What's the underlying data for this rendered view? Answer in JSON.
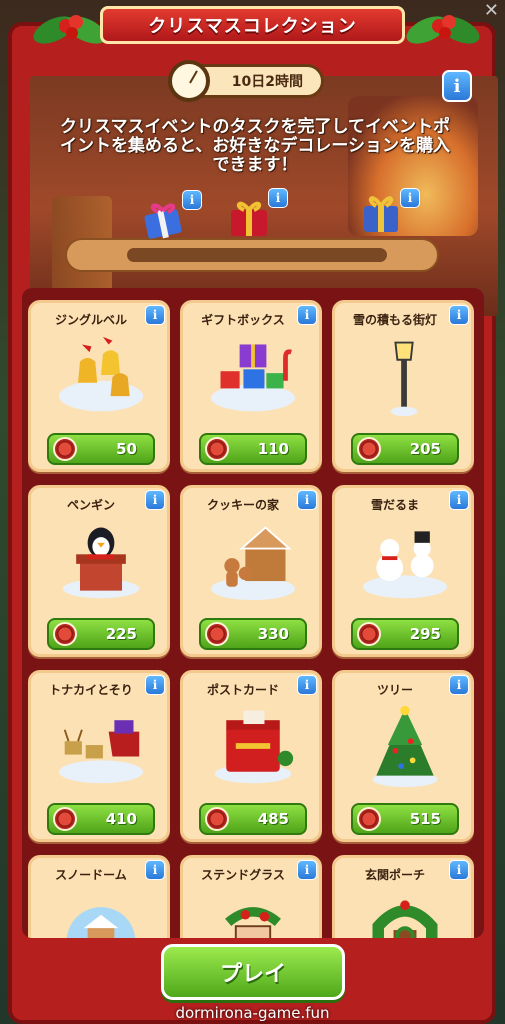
{
  "header": {
    "title": "クリスマスコレクション",
    "timer": "10日2時間",
    "description": "クリスマスイベントのタスクを完了してイベントポイントを集めると、お好きなデコレーションを購入できます！",
    "info_label": "i"
  },
  "progress": {
    "fraction": 0.0,
    "milestones": [
      "gift-blue-icon",
      "gift-red-icon",
      "gift-gold-icon"
    ]
  },
  "items": [
    {
      "name": "ジングルベル",
      "price": "50",
      "icon": "jingle-bells-icon"
    },
    {
      "name": "ギフトボックス",
      "price": "110",
      "icon": "gift-boxes-icon"
    },
    {
      "name": "雪の積もる街灯",
      "price": "205",
      "icon": "street-lamp-icon"
    },
    {
      "name": "ペンギン",
      "price": "225",
      "icon": "penguin-icon"
    },
    {
      "name": "クッキーの家",
      "price": "330",
      "icon": "gingerbread-house-icon"
    },
    {
      "name": "雪だるま",
      "price": "295",
      "icon": "snowman-icon"
    },
    {
      "name": "トナカイとそり",
      "price": "410",
      "icon": "reindeer-sleigh-icon"
    },
    {
      "name": "ポストカード",
      "price": "485",
      "icon": "mailbox-icon"
    },
    {
      "name": "ツリー",
      "price": "515",
      "icon": "christmas-tree-icon"
    },
    {
      "name": "スノードーム",
      "price": "",
      "icon": "snow-globe-icon"
    },
    {
      "name": "ステンドグラス",
      "price": "",
      "icon": "stained-glass-icon"
    },
    {
      "name": "玄関ポーチ",
      "price": "",
      "icon": "wreath-porch-icon"
    }
  ],
  "play_button": "プレイ",
  "watermark": "dormirona-game.fun",
  "colors": {
    "panel": "#b5201f",
    "card": "#fbe1b4",
    "price_green": "#5fb524",
    "info_blue": "#2a78d8"
  }
}
